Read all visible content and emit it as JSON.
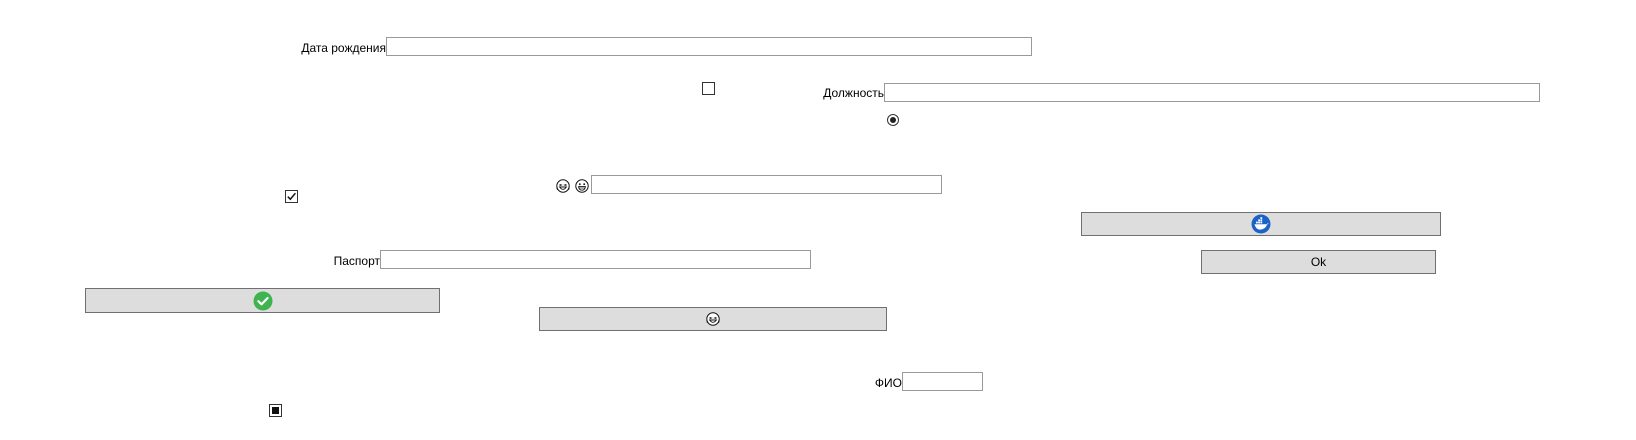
{
  "form": {
    "birth_date": {
      "label": "Дата рождения",
      "value": ""
    },
    "position": {
      "label": "Должность",
      "value": ""
    },
    "middle_input": {
      "value": ""
    },
    "passport": {
      "label": "Паспорт",
      "value": ""
    },
    "fio": {
      "label": "ФИО",
      "value": ""
    }
  },
  "controls": {
    "checkbox_top": {
      "checked": false
    },
    "radio_top": {
      "selected": true
    },
    "checkbox_left": {
      "checked": true
    },
    "checkbox_bottom": {
      "state": "indeterminate"
    }
  },
  "buttons": {
    "ok_label": "Ok",
    "docker_button_icon": "docker-icon",
    "green_check_button_icon": "check-circle-icon",
    "emoji_button_icon": "laughing-face-icon"
  },
  "icons": {
    "laughing": "laughing-face-icon",
    "grinning": "grinning-face-icon"
  },
  "colors": {
    "button_bg": "#dddddd",
    "button_border": "#707070",
    "input_border": "#9a9a9a",
    "check_green": "#3fb34f",
    "docker_blue": "#1d63c6"
  }
}
